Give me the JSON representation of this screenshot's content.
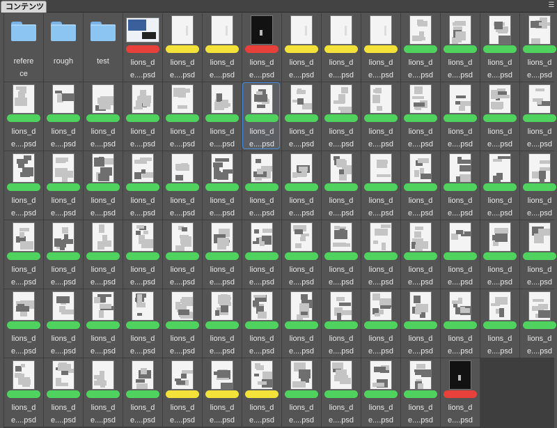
{
  "panel": {
    "tab_label": "コンテンツ",
    "menu_icon": "panel-menu-icon"
  },
  "colors": {
    "red": "#e8413c",
    "yellow": "#f2e23a",
    "green": "#4fd35e",
    "selection": "#4c8fe0"
  },
  "items": [
    {
      "type": "folder",
      "name": "reference",
      "label": "refere\nce"
    },
    {
      "type": "folder",
      "name": "rough",
      "label": "rough"
    },
    {
      "type": "folder",
      "name": "test",
      "label": "test"
    },
    {
      "type": "file",
      "thumb": "cover",
      "tag": "red",
      "label": "lions_d\ne....psd"
    },
    {
      "type": "file",
      "thumb": "blank",
      "tag": "yellow",
      "label": "lions_d\ne....psd"
    },
    {
      "type": "file",
      "thumb": "blank",
      "tag": "yellow",
      "label": "lions_d\ne....psd"
    },
    {
      "type": "file",
      "thumb": "dark",
      "tag": "red",
      "label": "lions_d\ne....psd"
    },
    {
      "type": "file",
      "thumb": "blank",
      "tag": "yellow",
      "label": "lions_d\ne....psd"
    },
    {
      "type": "file",
      "thumb": "blank",
      "tag": "yellow",
      "label": "lions_d\ne....psd"
    },
    {
      "type": "file",
      "thumb": "blank",
      "tag": "yellow",
      "label": "lions_d\ne....psd"
    },
    {
      "type": "file",
      "thumb": "page",
      "tag": "green",
      "label": "lions_d\ne....psd"
    },
    {
      "type": "file",
      "thumb": "page",
      "tag": "green",
      "label": "lions_d\ne....psd"
    },
    {
      "type": "file",
      "thumb": "page",
      "tag": "green",
      "label": "lions_d\ne....psd"
    },
    {
      "type": "file",
      "thumb": "page",
      "tag": "green",
      "label": "lions_d\ne....psd"
    },
    {
      "type": "file",
      "thumb": "page",
      "tag": "green",
      "label": "lions_d\ne....psd"
    },
    {
      "type": "file",
      "thumb": "page",
      "tag": "green",
      "label": "lions_d\ne....psd"
    },
    {
      "type": "file",
      "thumb": "page",
      "tag": "green",
      "label": "lions_d\ne....psd"
    },
    {
      "type": "file",
      "thumb": "page",
      "tag": "green",
      "label": "lions_d\ne....psd"
    },
    {
      "type": "file",
      "thumb": "page",
      "tag": "green",
      "label": "lions_d\ne....psd"
    },
    {
      "type": "file",
      "thumb": "page",
      "tag": "green",
      "label": "lions_d\ne....psd"
    },
    {
      "type": "file",
      "thumb": "page",
      "tag": "green",
      "label": "lions_d\ne....psd",
      "selected": true
    },
    {
      "type": "file",
      "thumb": "page",
      "tag": "green",
      "label": "lions_d\ne....psd"
    },
    {
      "type": "file",
      "thumb": "page",
      "tag": "green",
      "label": "lions_d\ne....psd"
    },
    {
      "type": "file",
      "thumb": "page",
      "tag": "green",
      "label": "lions_d\ne....psd"
    },
    {
      "type": "file",
      "thumb": "page",
      "tag": "green",
      "label": "lions_d\ne....psd"
    },
    {
      "type": "file",
      "thumb": "page",
      "tag": "green",
      "label": "lions_d\ne....psd"
    },
    {
      "type": "file",
      "thumb": "page",
      "tag": "green",
      "label": "lions_d\ne....psd"
    },
    {
      "type": "file",
      "thumb": "page",
      "tag": "green",
      "label": "lions_d\ne....psd"
    },
    {
      "type": "file",
      "thumb": "page",
      "tag": "green",
      "label": "lions_d\ne....psd"
    },
    {
      "type": "file",
      "thumb": "page",
      "tag": "green",
      "label": "lions_d\ne....psd"
    },
    {
      "type": "file",
      "thumb": "page",
      "tag": "green",
      "label": "lions_d\ne....psd"
    },
    {
      "type": "file",
      "thumb": "page",
      "tag": "green",
      "label": "lions_d\ne....psd"
    },
    {
      "type": "file",
      "thumb": "page",
      "tag": "green",
      "label": "lions_d\ne....psd"
    },
    {
      "type": "file",
      "thumb": "page",
      "tag": "green",
      "label": "lions_d\ne....psd"
    },
    {
      "type": "file",
      "thumb": "page",
      "tag": "green",
      "label": "lions_d\ne....psd"
    },
    {
      "type": "file",
      "thumb": "page",
      "tag": "green",
      "label": "lions_d\ne....psd"
    },
    {
      "type": "file",
      "thumb": "page",
      "tag": "green",
      "label": "lions_d\ne....psd"
    },
    {
      "type": "file",
      "thumb": "page",
      "tag": "green",
      "label": "lions_d\ne....psd"
    },
    {
      "type": "file",
      "thumb": "page",
      "tag": "green",
      "label": "lions_d\ne....psd"
    },
    {
      "type": "file",
      "thumb": "page",
      "tag": "green",
      "label": "lions_d\ne....psd"
    },
    {
      "type": "file",
      "thumb": "page",
      "tag": "green",
      "label": "lions_d\ne....psd"
    },
    {
      "type": "file",
      "thumb": "page",
      "tag": "green",
      "label": "lions_d\ne....psd"
    },
    {
      "type": "file",
      "thumb": "page",
      "tag": "green",
      "label": "lions_d\ne....psd"
    },
    {
      "type": "file",
      "thumb": "page",
      "tag": "green",
      "label": "lions_d\ne....psd"
    },
    {
      "type": "file",
      "thumb": "page",
      "tag": "green",
      "label": "lions_d\ne....psd"
    },
    {
      "type": "file",
      "thumb": "page",
      "tag": "green",
      "label": "lions_d\ne....psd"
    },
    {
      "type": "file",
      "thumb": "page",
      "tag": "green",
      "label": "lions_d\ne....psd"
    },
    {
      "type": "file",
      "thumb": "page",
      "tag": "green",
      "label": "lions_d\ne....psd"
    },
    {
      "type": "file",
      "thumb": "page",
      "tag": "green",
      "label": "lions_d\ne....psd"
    },
    {
      "type": "file",
      "thumb": "page",
      "tag": "green",
      "label": "lions_d\ne....psd"
    },
    {
      "type": "file",
      "thumb": "page",
      "tag": "green",
      "label": "lions_d\ne....psd"
    },
    {
      "type": "file",
      "thumb": "page",
      "tag": "green",
      "label": "lions_d\ne....psd"
    },
    {
      "type": "file",
      "thumb": "page",
      "tag": "green",
      "label": "lions_d\ne....psd"
    },
    {
      "type": "file",
      "thumb": "page",
      "tag": "green",
      "label": "lions_d\ne....psd"
    },
    {
      "type": "file",
      "thumb": "page",
      "tag": "green",
      "label": "lions_d\ne....psd"
    },
    {
      "type": "file",
      "thumb": "page",
      "tag": "green",
      "label": "lions_d\ne....psd"
    },
    {
      "type": "file",
      "thumb": "page",
      "tag": "green",
      "label": "lions_d\ne....psd"
    },
    {
      "type": "file",
      "thumb": "page",
      "tag": "green",
      "label": "lions_d\ne....psd"
    },
    {
      "type": "file",
      "thumb": "page",
      "tag": "green",
      "label": "lions_d\ne....psd"
    },
    {
      "type": "file",
      "thumb": "page",
      "tag": "green",
      "label": "lions_d\ne....psd"
    },
    {
      "type": "file",
      "thumb": "page",
      "tag": "green",
      "label": "lions_d\ne....psd"
    },
    {
      "type": "file",
      "thumb": "page",
      "tag": "green",
      "label": "lions_d\ne....psd"
    },
    {
      "type": "file",
      "thumb": "page",
      "tag": "green",
      "label": "lions_d\ne....psd"
    },
    {
      "type": "file",
      "thumb": "page",
      "tag": "green",
      "label": "lions_d\ne....psd"
    },
    {
      "type": "file",
      "thumb": "page",
      "tag": "green",
      "label": "lions_d\ne....psd"
    },
    {
      "type": "file",
      "thumb": "page",
      "tag": "green",
      "label": "lions_d\ne....psd"
    },
    {
      "type": "file",
      "thumb": "page",
      "tag": "green",
      "label": "lions_d\ne....psd"
    },
    {
      "type": "file",
      "thumb": "page",
      "tag": "green",
      "label": "lions_d\ne....psd"
    },
    {
      "type": "file",
      "thumb": "page",
      "tag": "green",
      "label": "lions_d\ne....psd"
    },
    {
      "type": "file",
      "thumb": "page",
      "tag": "green",
      "label": "lions_d\ne....psd"
    },
    {
      "type": "file",
      "thumb": "page",
      "tag": "green",
      "label": "lions_d\ne....psd"
    },
    {
      "type": "file",
      "thumb": "page",
      "tag": "green",
      "label": "lions_d\ne....psd"
    },
    {
      "type": "file",
      "thumb": "page",
      "tag": "green",
      "label": "lions_d\ne....psd"
    },
    {
      "type": "file",
      "thumb": "page",
      "tag": "green",
      "label": "lions_d\ne....psd"
    },
    {
      "type": "file",
      "thumb": "page",
      "tag": "yellow",
      "label": "lions_d\ne....psd"
    },
    {
      "type": "file",
      "thumb": "page",
      "tag": "yellow",
      "label": "lions_d\ne....psd"
    },
    {
      "type": "file",
      "thumb": "page",
      "tag": "yellow",
      "label": "lions_d\ne....psd"
    },
    {
      "type": "file",
      "thumb": "page",
      "tag": "green",
      "label": "lions_d\ne....psd"
    },
    {
      "type": "file",
      "thumb": "page",
      "tag": "green",
      "label": "lions_d\ne....psd"
    },
    {
      "type": "file",
      "thumb": "page",
      "tag": "green",
      "label": "lions_d\ne....psd"
    },
    {
      "type": "file",
      "thumb": "page",
      "tag": "green",
      "label": "lions_d\ne....psd"
    },
    {
      "type": "file",
      "thumb": "dark",
      "tag": "red",
      "label": "lions_d\ne....psd"
    }
  ]
}
